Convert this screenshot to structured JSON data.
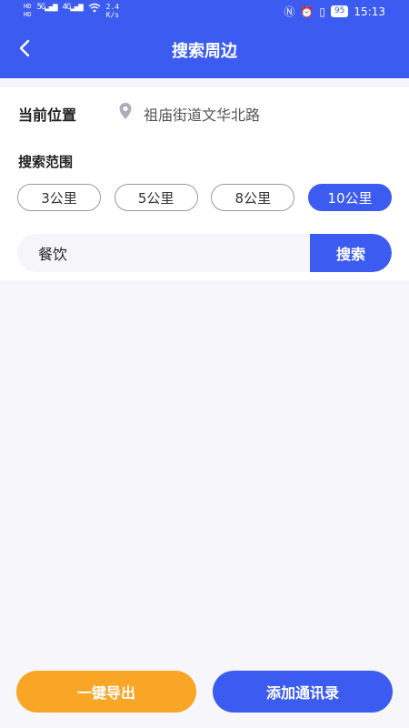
{
  "status_bar": {
    "hd1": "HD",
    "hd2": "HD",
    "net1": "5G",
    "net2": "4G",
    "speed_value": "2.4",
    "speed_unit": "K/s",
    "battery": "95",
    "time": "15:13"
  },
  "header": {
    "title": "搜索周边"
  },
  "location": {
    "label": "当前位置",
    "value": "祖庙街道文华北路"
  },
  "range": {
    "label": "搜索范围",
    "options": [
      "3公里",
      "5公里",
      "8公里",
      "10公里"
    ],
    "selected_index": 3
  },
  "search": {
    "value": "餐饮",
    "button_label": "搜索"
  },
  "actions": {
    "export_label": "一键导出",
    "add_contacts_label": "添加通讯录"
  },
  "colors": {
    "primary": "#3c5bf0",
    "accent": "#f9a526",
    "background": "#f7f6fa"
  }
}
